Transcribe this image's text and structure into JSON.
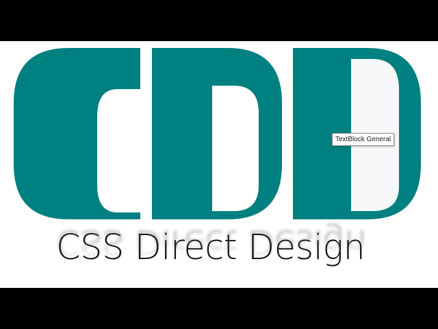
{
  "title": "CSS Direct Design",
  "tooltip": "TextBlock General",
  "logo": {
    "letters": [
      "C",
      "D",
      "D"
    ],
    "color": "#008080",
    "panel_color": "#f6f7f8"
  },
  "colors": {
    "background": "#ffffff",
    "letterbox": "#000000",
    "text": "#111111"
  }
}
